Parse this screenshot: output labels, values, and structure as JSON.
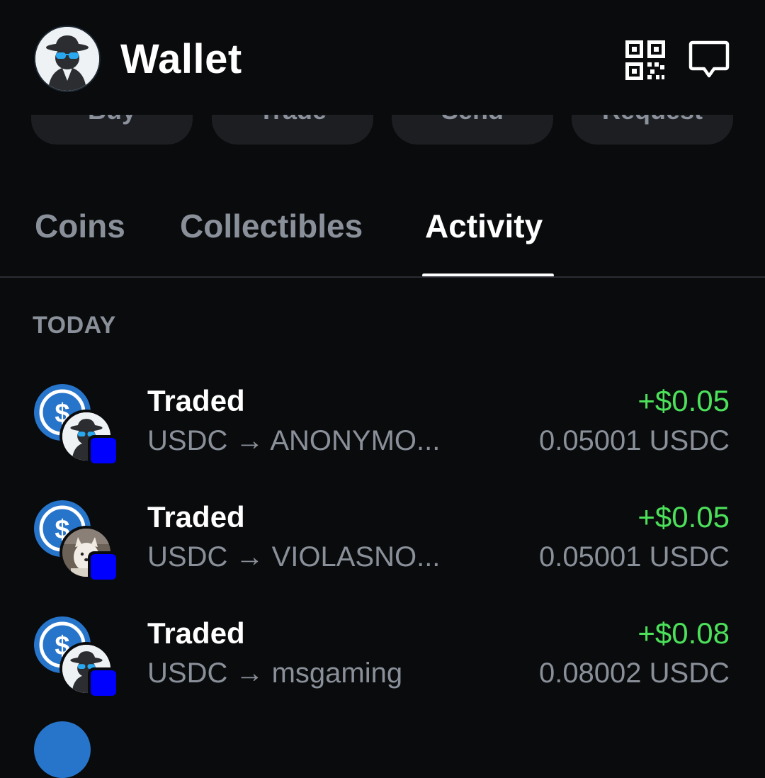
{
  "header": {
    "title": "Wallet",
    "avatar_icon": "spy-avatar-icon",
    "qr_icon": "qr-code-icon",
    "message_icon": "chat-bubble-icon"
  },
  "actions": [
    {
      "label": "Buy"
    },
    {
      "label": "Trade"
    },
    {
      "label": "Send"
    },
    {
      "label": "Request"
    }
  ],
  "tabs": [
    {
      "label": "Coins",
      "active": false
    },
    {
      "label": "Collectibles",
      "active": false
    },
    {
      "label": "Activity",
      "active": true
    }
  ],
  "activity": {
    "section_label": "TODAY",
    "items": [
      {
        "title": "Traded",
        "subtitle": "USDC → ANONYMO...",
        "amount_usd": "+$0.05",
        "amount_token": "0.05001 USDC",
        "coin_icon": "usdc-icon",
        "token_icon": "spy-avatar-icon",
        "chain_icon": "blue-square-chain-icon"
      },
      {
        "title": "Traded",
        "subtitle": "USDC → VIOLASNO...",
        "amount_usd": "+$0.05",
        "amount_token": "0.05001 USDC",
        "coin_icon": "usdc-icon",
        "token_icon": "dog-photo-icon",
        "chain_icon": "blue-square-chain-icon"
      },
      {
        "title": "Traded",
        "subtitle": "USDC → msgaming",
        "amount_usd": "+$0.08",
        "amount_token": "0.08002 USDC",
        "coin_icon": "usdc-icon",
        "token_icon": "spy-avatar-icon",
        "chain_icon": "blue-square-chain-icon"
      }
    ]
  },
  "colors": {
    "background": "#0a0b0d",
    "positive": "#4ce15a",
    "muted": "#8a9099",
    "usdc": "#2775ca",
    "chain": "#0000ff"
  }
}
